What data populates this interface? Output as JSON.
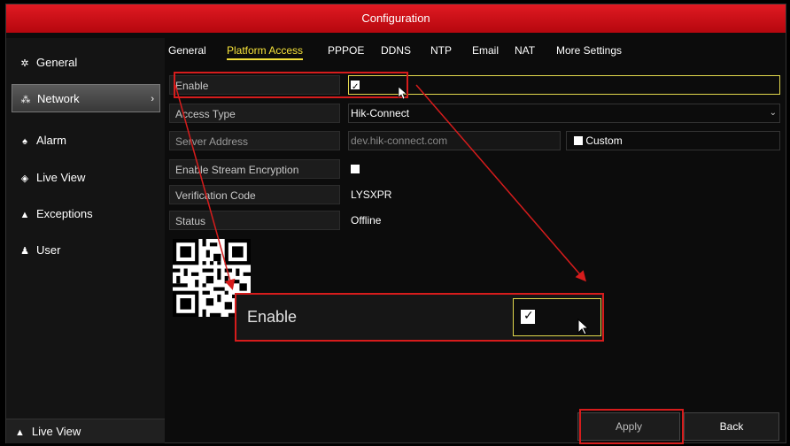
{
  "window": {
    "title": "Configuration"
  },
  "sidebar": {
    "items": [
      {
        "label": "General",
        "icon": "gear-icon"
      },
      {
        "label": "Network",
        "icon": "network-icon",
        "chevron": "›"
      },
      {
        "label": "Alarm",
        "icon": "alarm-icon"
      },
      {
        "label": "Live View",
        "icon": "eye-icon"
      },
      {
        "label": "Exceptions",
        "icon": "warning-icon"
      },
      {
        "label": "User",
        "icon": "users-icon"
      }
    ],
    "footer": {
      "label": "Live View",
      "icon": "home-icon"
    }
  },
  "tabs": [
    "General",
    "Platform Access",
    "PPPOE",
    "DDNS",
    "NTP",
    "Email",
    "NAT",
    "More Settings"
  ],
  "form": {
    "enable_label": "Enable",
    "access_type_label": "Access Type",
    "access_type_value": "Hik-Connect",
    "server_address_label": "Server Address",
    "server_address_value": "dev.hik-connect.com",
    "custom_label": "Custom",
    "encryption_label": "Enable Stream Encryption",
    "verification_label": "Verification Code",
    "verification_value": "LYSXPR",
    "status_label": "Status",
    "status_value": "Offline"
  },
  "zoom": {
    "label": "Enable"
  },
  "buttons": {
    "apply": "Apply",
    "back": "Back"
  },
  "colors": {
    "title_red": "#c8101a",
    "active_tab": "#f5e23a",
    "annotation_red": "#d61c1c"
  }
}
